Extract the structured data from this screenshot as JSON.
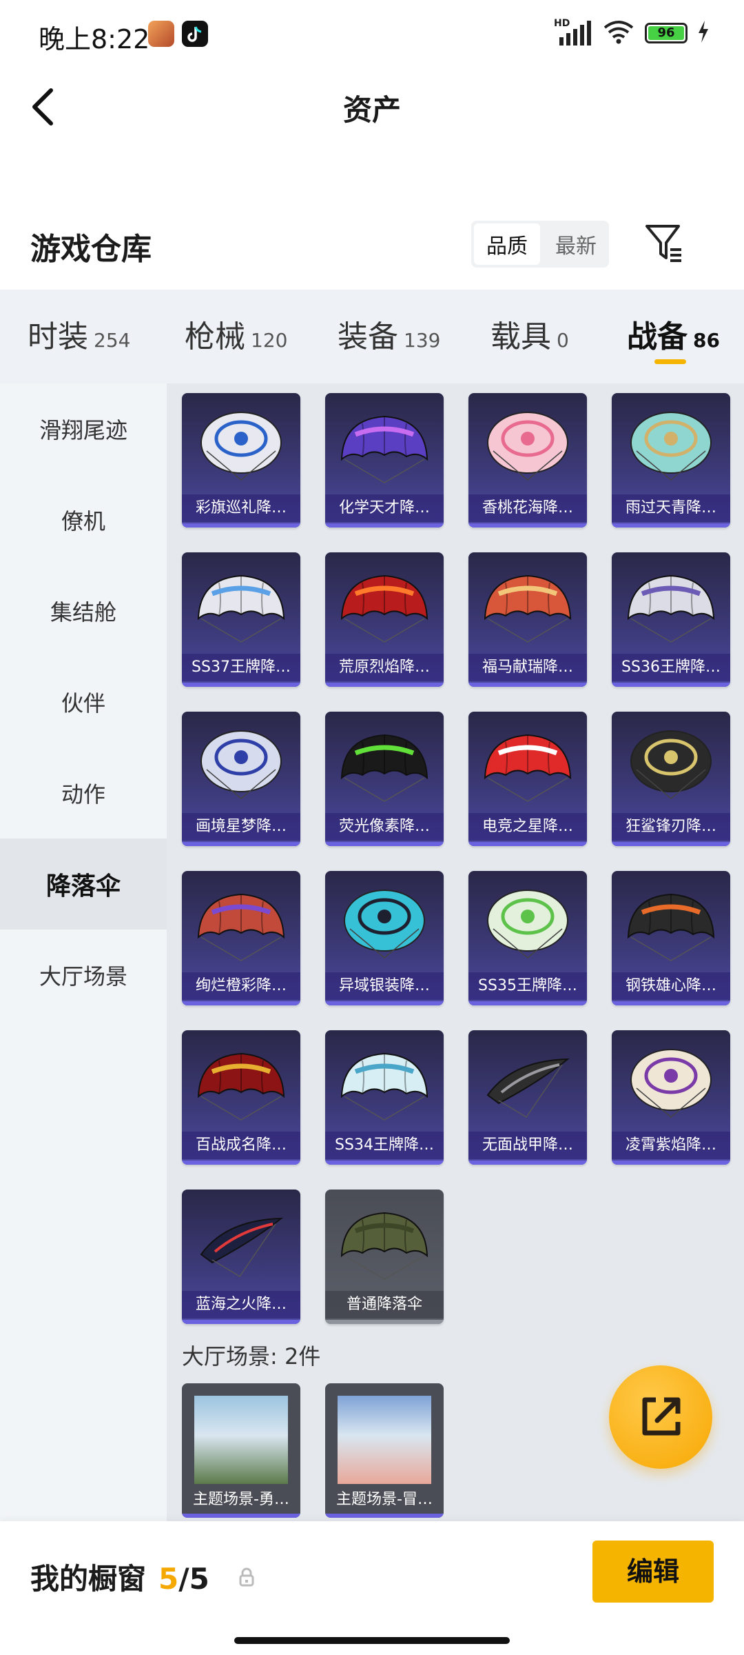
{
  "status_bar": {
    "time": "晚上8:22",
    "network": "HD",
    "battery": "96"
  },
  "header": {
    "title": "资产"
  },
  "warehouse": {
    "title": "游戏仓库",
    "sort_quality": "品质",
    "sort_newest": "最新"
  },
  "tabs": [
    {
      "label": "时装",
      "count": "254"
    },
    {
      "label": "枪械",
      "count": "120"
    },
    {
      "label": "装备",
      "count": "139"
    },
    {
      "label": "载具",
      "count": "0"
    },
    {
      "label": "战备",
      "count": "86"
    }
  ],
  "sidebar": {
    "items": [
      "滑翔尾迹",
      "僚机",
      "集结舱",
      "伙伴",
      "动作",
      "降落伞",
      "大厅场景"
    ],
    "active": "降落伞"
  },
  "parachutes": [
    {
      "label": "彩旗巡礼降…",
      "color": "#e8e8f0",
      "accent": "#2a62c9",
      "shape": "round"
    },
    {
      "label": "化学天才降…",
      "color": "#5a3fc2",
      "accent": "#c86cf0",
      "shape": "canopy"
    },
    {
      "label": "香桃花海降…",
      "color": "#f6c7d3",
      "accent": "#e86b8f",
      "shape": "round"
    },
    {
      "label": "雨过天青降…",
      "color": "#8fd6d0",
      "accent": "#d2b16a",
      "shape": "round"
    },
    {
      "label": "SS37王牌降…",
      "color": "#e6e6ee",
      "accent": "#5aa0e6",
      "shape": "canopy"
    },
    {
      "label": "荒原烈焰降…",
      "color": "#b81c1c",
      "accent": "#ff7a2a",
      "shape": "canopy"
    },
    {
      "label": "福马献瑞降…",
      "color": "#d8563a",
      "accent": "#f2c77a",
      "shape": "canopy"
    },
    {
      "label": "SS36王牌降…",
      "color": "#dcdce6",
      "accent": "#6b5bb5",
      "shape": "canopy"
    },
    {
      "label": "画境星梦降…",
      "color": "#d7dbee",
      "accent": "#2e3fa8",
      "shape": "round"
    },
    {
      "label": "荧光像素降…",
      "color": "#1a1a1a",
      "accent": "#62e03a",
      "shape": "canopy"
    },
    {
      "label": "电竞之星降…",
      "color": "#e02a2a",
      "accent": "#ffffff",
      "shape": "canopy"
    },
    {
      "label": "狂鲨锋刃降…",
      "color": "#2a2a2a",
      "accent": "#d9c46e",
      "shape": "round"
    },
    {
      "label": "绚烂橙彩降…",
      "color": "#c24a3a",
      "accent": "#7a4ad0",
      "shape": "canopy"
    },
    {
      "label": "异域银装降…",
      "color": "#36c1d6",
      "accent": "#1e2030",
      "shape": "round"
    },
    {
      "label": "SS35王牌降…",
      "color": "#e2f0dc",
      "accent": "#5cc24a",
      "shape": "round"
    },
    {
      "label": "钢铁雄心降…",
      "color": "#2a2a2a",
      "accent": "#e86b2a",
      "shape": "canopy"
    },
    {
      "label": "百战成名降…",
      "color": "#8c1414",
      "accent": "#e8b030",
      "shape": "canopy"
    },
    {
      "label": "SS34王牌降…",
      "color": "#d6eef4",
      "accent": "#4aa6c8",
      "shape": "canopy"
    },
    {
      "label": "无面战甲降…",
      "color": "#2e2e2e",
      "accent": "#9a9aa0",
      "shape": "thin"
    },
    {
      "label": "凌霄紫焰降…",
      "color": "#efe6d6",
      "accent": "#7a3aa8",
      "shape": "round"
    },
    {
      "label": "蓝海之火降…",
      "color": "#1e2040",
      "accent": "#e23a3a",
      "shape": "thin"
    },
    {
      "label": "普通降落伞",
      "color": "#55603a",
      "accent": "#3e4628",
      "shape": "canopy",
      "gray": true
    }
  ],
  "lobby": {
    "title": "大厅场景: 2件",
    "scenes": [
      {
        "label": "主题场景-勇…",
        "sky": "#9cc4e0",
        "ground": "#5b7a4a"
      },
      {
        "label": "主题场景-冒…",
        "sky": "#7fa2d6",
        "ground": "#e8a89a"
      }
    ]
  },
  "bottom": {
    "showcase_label": "我的橱窗",
    "showcase_current": "5",
    "showcase_total": "/5",
    "edit_label": "编辑"
  },
  "colors": {
    "accent": "#f5b400",
    "card_bg": "#3d3a7a",
    "sidebar_bg": "#f2f5f8"
  }
}
